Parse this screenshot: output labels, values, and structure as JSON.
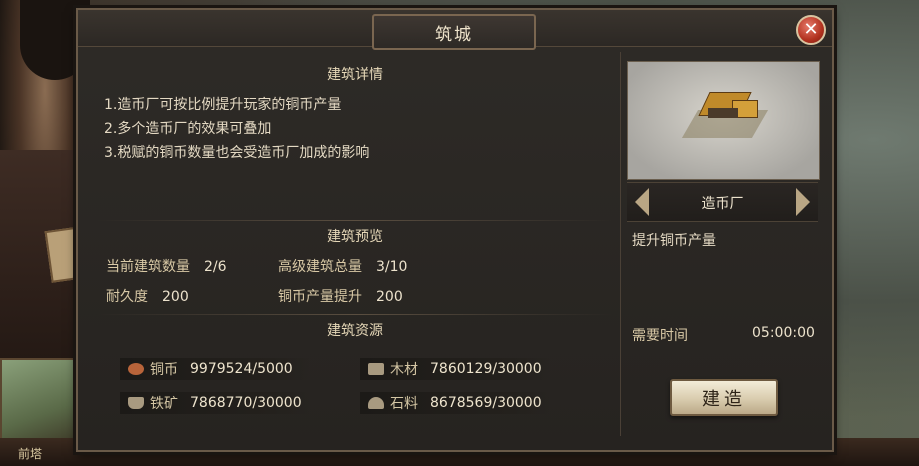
{
  "window": {
    "title": "筑城",
    "close_icon": "close-icon"
  },
  "details": {
    "heading": "建筑详情",
    "lines": [
      "1.造币厂可按比例提升玩家的铜币产量",
      "2.多个造币厂的效果可叠加",
      "3.税赋的铜币数量也会受造币厂加成的影响"
    ]
  },
  "preview_section": {
    "heading": "建筑预览",
    "stats": [
      {
        "label": "当前建筑数量",
        "value": "2/6"
      },
      {
        "label": "高级建筑总量",
        "value": "3/10"
      },
      {
        "label": "耐久度",
        "value": "200"
      },
      {
        "label": "铜币产量提升",
        "value": "200"
      }
    ]
  },
  "resources": {
    "heading": "建筑资源",
    "items": [
      {
        "icon": "copper-coin-icon",
        "label": "铜币",
        "value": "9979524/5000",
        "color": "#b8643a"
      },
      {
        "icon": "wood-icon",
        "label": "木材",
        "value": "7860129/30000",
        "color": "#a89a80"
      },
      {
        "icon": "iron-ore-icon",
        "label": "铁矿",
        "value": "7868770/30000",
        "color": "#a89a80"
      },
      {
        "icon": "stone-icon",
        "label": "石料",
        "value": "8678569/30000",
        "color": "#a89a80"
      }
    ]
  },
  "building": {
    "name": "造币厂",
    "description": "提升铜币产量",
    "time_label": "需要时间",
    "time_value": "05:00:00",
    "build_label": "建造"
  },
  "background": {
    "bottom_label": "前塔"
  },
  "colors": {
    "accent": "#b2321f",
    "text": "#e8dcc0"
  }
}
